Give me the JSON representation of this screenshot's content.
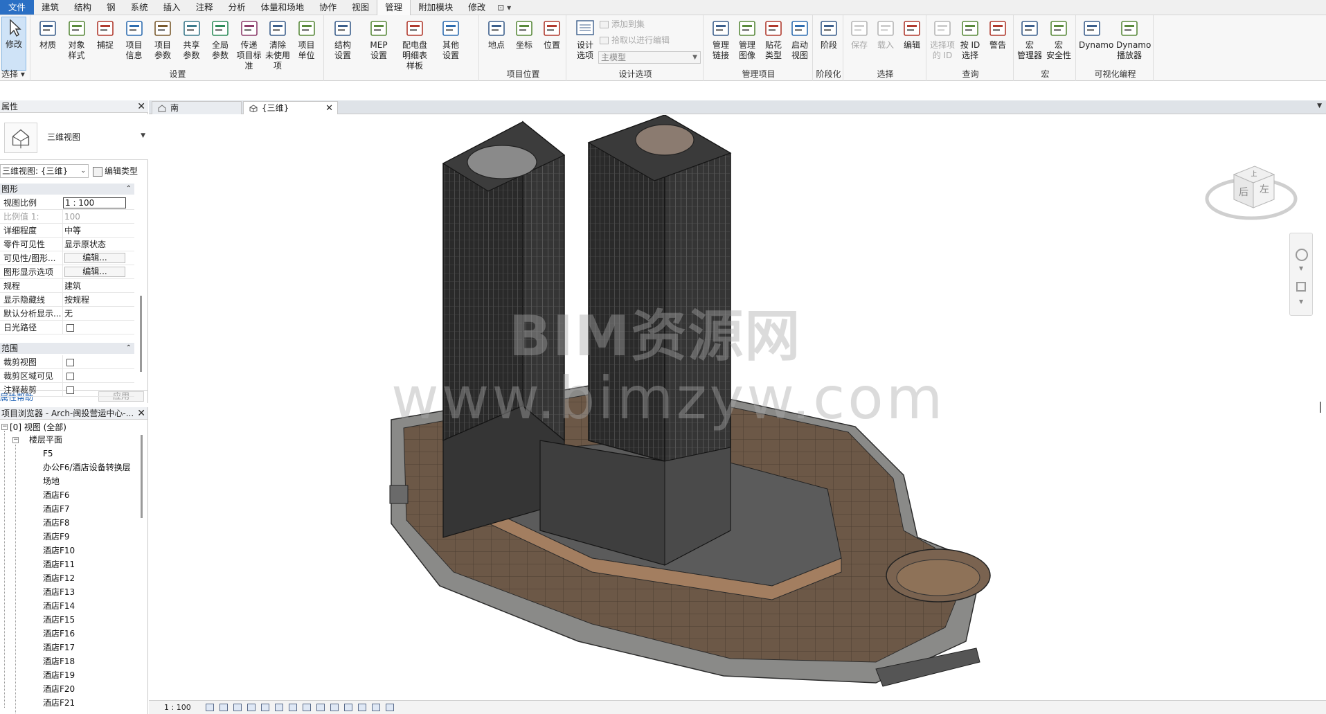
{
  "menu": {
    "tabs": [
      "文件",
      "建筑",
      "结构",
      "钢",
      "系统",
      "插入",
      "注释",
      "分析",
      "体量和场地",
      "协作",
      "视图",
      "管理",
      "附加模块",
      "修改"
    ],
    "active": "管理",
    "extra": "⊡ ▾"
  },
  "ribbon": {
    "modify": "修改",
    "select_group": "选择 ▾",
    "settings": {
      "buttons": [
        "材质",
        "对象\n样式",
        "捕捉",
        "项目\n信息",
        "项目\n参数",
        "共享\n参数",
        "全局\n参数",
        "传递\n项目标准",
        "清除\n未使用项",
        "项目\n单位"
      ],
      "label": "设置"
    },
    "structure": {
      "buttons": [
        "结构\n设置",
        "MEP\n设置",
        "配电盘明细表\n样板",
        "其他\n设置"
      ]
    },
    "location": {
      "buttons": [
        "地点",
        "坐标",
        "位置"
      ],
      "label": "项目位置"
    },
    "design_options": {
      "button": "设计\n选项",
      "add_to_set": "添加到集",
      "pick_edit": "拾取以进行编辑",
      "combo": "主模型",
      "label": "设计选项"
    },
    "manage_project": {
      "buttons": [
        "管理\n链接",
        "管理\n图像",
        "贴花\n类型",
        "启动\n视图"
      ],
      "label": "管理项目"
    },
    "phasing": {
      "button": "阶段",
      "label": "阶段化"
    },
    "selection": {
      "buttons": [
        "保存",
        "载入",
        "编辑"
      ],
      "label": "选择"
    },
    "inquiry": {
      "buttons": [
        "选择项\n的 ID",
        "按 ID\n选择",
        "警告"
      ],
      "label": "查询"
    },
    "macros": {
      "buttons": [
        "宏\n管理器",
        "宏\n安全性"
      ],
      "label": "宏"
    },
    "visual": {
      "buttons": [
        "Dynamo",
        "Dynamo\n播放器"
      ],
      "label": "可视化编程"
    }
  },
  "properties": {
    "title": "属性",
    "type_name": "三维视图",
    "view_select": "三维视图: {三维}",
    "edit_type": "编辑类型",
    "section_graphics": "图形",
    "rows": [
      {
        "k": "视图比例",
        "v": "1 : 100"
      },
      {
        "k": "比例值 1:",
        "v": "100"
      },
      {
        "k": "详细程度",
        "v": "中等"
      },
      {
        "k": "零件可见性",
        "v": "显示原状态"
      },
      {
        "k": "可见性/图形...",
        "v": "编辑..."
      },
      {
        "k": "图形显示选项",
        "v": "编辑..."
      },
      {
        "k": "规程",
        "v": "建筑"
      },
      {
        "k": "显示隐藏线",
        "v": "按规程"
      },
      {
        "k": "默认分析显示...",
        "v": "无"
      },
      {
        "k": "日光路径",
        "v": ""
      }
    ],
    "section_extents": "范围",
    "rows2": [
      {
        "k": "裁剪视图",
        "v": ""
      },
      {
        "k": "裁剪区域可见",
        "v": ""
      },
      {
        "k": "注释裁剪",
        "v": ""
      }
    ],
    "help": "属性帮助",
    "apply": "应用"
  },
  "browser": {
    "title": "项目浏览器 - Arch-闽投营运中心-...",
    "root": "[0] 视图 (全部)",
    "floorplans": "楼层平面",
    "items": [
      "F5",
      "办公F6/酒店设备转换层",
      "场地",
      "酒店F6",
      "酒店F7",
      "酒店F8",
      "酒店F9",
      "酒店F10",
      "酒店F11",
      "酒店F12",
      "酒店F13",
      "酒店F14",
      "酒店F15",
      "酒店F16",
      "酒店F17",
      "酒店F18",
      "酒店F19",
      "酒店F20",
      "酒店F21"
    ]
  },
  "tabs": {
    "south": "南",
    "threed": "{三维}"
  },
  "viewport": {
    "watermark1": "BIM资源网",
    "watermark2": "www.bimzyw.com",
    "cube_top": "上",
    "cube_back": "后",
    "cube_left": "左"
  },
  "viewctrl": {
    "scale": "1 : 100"
  },
  "colors": {
    "file_tab": "#2a6fc4",
    "podium": "#6b5645",
    "tower": "#2e2e2e"
  }
}
